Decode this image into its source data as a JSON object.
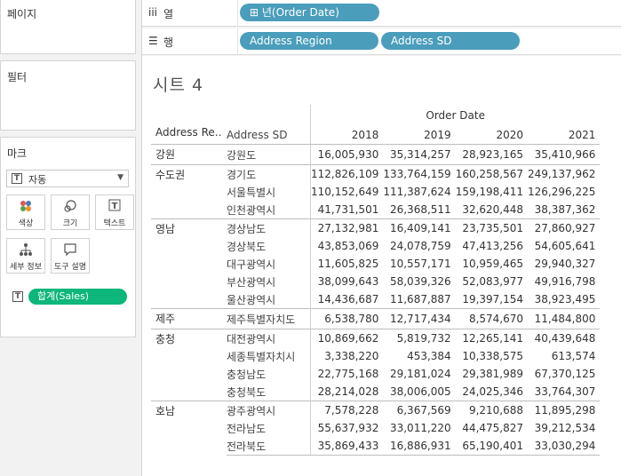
{
  "left_panel": {
    "pages_title": "페이지",
    "filters_title": "필터",
    "marks_title": "마크",
    "mark_type": "자동",
    "mark_buttons": [
      {
        "label": "색상",
        "icon": "color-dots-icon"
      },
      {
        "label": "크기",
        "icon": "size-circles-icon"
      },
      {
        "label": "텍스트",
        "icon": "text-t-icon"
      },
      {
        "label": "세부 정보",
        "icon": "detail-hierarchy-icon"
      },
      {
        "label": "도구 설명",
        "icon": "tooltip-bubble-icon"
      }
    ],
    "measure_pill": "합계(Sales)"
  },
  "shelves": {
    "columns_label": "열",
    "rows_label": "행",
    "columns_pills": [
      "⊞ 년(Order Date)"
    ],
    "rows_pills": [
      "Address Region",
      "Address SD"
    ]
  },
  "sheet": {
    "title": "시트 4",
    "col_group_header": "Order Date",
    "row_headers": [
      "Address Re..",
      "Address SD"
    ],
    "years": [
      "2018",
      "2019",
      "2020",
      "2021"
    ],
    "groups": [
      {
        "region": "강원",
        "rows": [
          {
            "sd": "강원도",
            "v": [
              "16,005,930",
              "35,314,257",
              "28,923,165",
              "35,410,966"
            ]
          }
        ]
      },
      {
        "region": "수도권",
        "rows": [
          {
            "sd": "경기도",
            "v": [
              "112,826,109",
              "133,764,159",
              "160,258,567",
              "249,137,962"
            ]
          },
          {
            "sd": "서울특별시",
            "v": [
              "110,152,649",
              "111,387,624",
              "159,198,411",
              "126,296,225"
            ]
          },
          {
            "sd": "인천광역시",
            "v": [
              "41,731,501",
              "26,368,511",
              "32,620,448",
              "38,387,362"
            ]
          }
        ]
      },
      {
        "region": "영남",
        "rows": [
          {
            "sd": "경상남도",
            "v": [
              "27,132,981",
              "16,409,141",
              "23,735,501",
              "27,860,927"
            ]
          },
          {
            "sd": "경상북도",
            "v": [
              "43,853,069",
              "24,078,759",
              "47,413,256",
              "54,605,641"
            ]
          },
          {
            "sd": "대구광역시",
            "v": [
              "11,605,825",
              "10,557,171",
              "10,959,465",
              "29,940,327"
            ]
          },
          {
            "sd": "부산광역시",
            "v": [
              "38,099,643",
              "58,039,326",
              "52,083,977",
              "49,916,798"
            ]
          },
          {
            "sd": "울산광역시",
            "v": [
              "14,436,687",
              "11,687,887",
              "19,397,154",
              "38,923,495"
            ]
          }
        ]
      },
      {
        "region": "제주",
        "rows": [
          {
            "sd": "제주특별자치도",
            "v": [
              "6,538,780",
              "12,717,434",
              "8,574,670",
              "11,484,800"
            ]
          }
        ]
      },
      {
        "region": "충청",
        "rows": [
          {
            "sd": "대전광역시",
            "v": [
              "10,869,662",
              "5,819,732",
              "12,265,141",
              "40,439,648"
            ]
          },
          {
            "sd": "세종특별자치시",
            "v": [
              "3,338,220",
              "453,384",
              "10,338,575",
              "613,574"
            ]
          },
          {
            "sd": "충청남도",
            "v": [
              "22,775,168",
              "29,181,024",
              "29,381,989",
              "67,370,125"
            ]
          },
          {
            "sd": "충청북도",
            "v": [
              "28,214,028",
              "38,006,005",
              "24,025,346",
              "33,764,307"
            ]
          }
        ]
      },
      {
        "region": "호남",
        "rows": [
          {
            "sd": "광주광역시",
            "v": [
              "7,578,228",
              "6,367,569",
              "9,210,688",
              "11,895,298"
            ]
          },
          {
            "sd": "전라남도",
            "v": [
              "55,637,932",
              "33,011,220",
              "44,475,827",
              "39,212,534"
            ]
          },
          {
            "sd": "전라북도",
            "v": [
              "35,869,433",
              "16,886,931",
              "65,190,401",
              "33,030,294"
            ]
          }
        ]
      }
    ]
  }
}
